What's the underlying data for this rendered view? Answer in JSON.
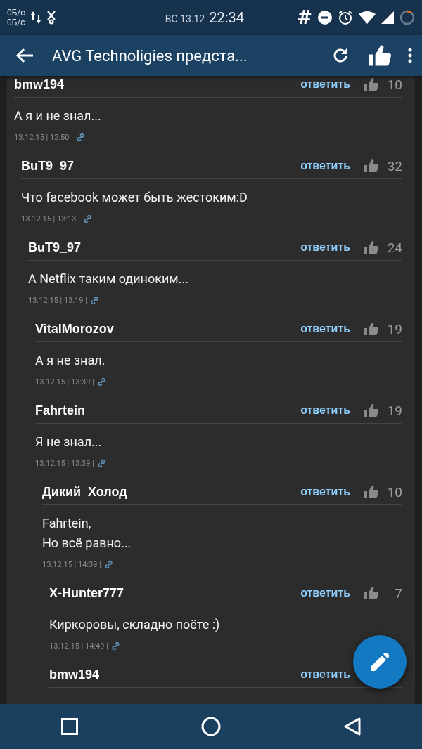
{
  "status_bar": {
    "speed_up": "0Б/с",
    "speed_down": "0Б/с",
    "date": "ВС 13.12",
    "time": "22:34",
    "hash": "#"
  },
  "app_bar": {
    "title": "AVG Technoligies предста..."
  },
  "comments": [
    {
      "author": "bmw194",
      "reply": "ответить",
      "likes": "10",
      "text": "А я и не знал...",
      "meta": "13.12.15 | 12:50 |",
      "children": [
        {
          "author": "BuT9_97",
          "reply": "ответить",
          "likes": "32",
          "text": "Что facebook может быть жестоким:D",
          "meta": "13.12.15 | 13:13 |",
          "children": [
            {
              "author": "BuT9_97",
              "reply": "ответить",
              "likes": "24",
              "text": "А Netflix таким одиноким...",
              "meta": "13.12.15 | 13:19 |",
              "children": [
                {
                  "author": "VitalMorozov",
                  "reply": "ответить",
                  "likes": "19",
                  "text": "А я не знал.",
                  "meta": "13.12.15 | 13:39 |"
                },
                {
                  "author": "Fahrtein",
                  "reply": "ответить",
                  "likes": "19",
                  "text": "Я не знал...",
                  "meta": "13.12.15 | 13:39 |",
                  "children": [
                    {
                      "author": "Дикий_Холод",
                      "reply": "ответить",
                      "likes": "10",
                      "text": "Fahrtein,\nНо всё равно...",
                      "meta": "13.12.15 | 14:39 |",
                      "children": [
                        {
                          "author": "X-Hunter777",
                          "reply": "ответить",
                          "likes": "7",
                          "text": "Киркоровы, складно поёте :)",
                          "meta": "13.12.15 | 14:49 |"
                        },
                        {
                          "author": "bmw194",
                          "reply": "ответить"
                        }
                      ]
                    }
                  ]
                }
              ]
            }
          ]
        }
      ]
    }
  ]
}
